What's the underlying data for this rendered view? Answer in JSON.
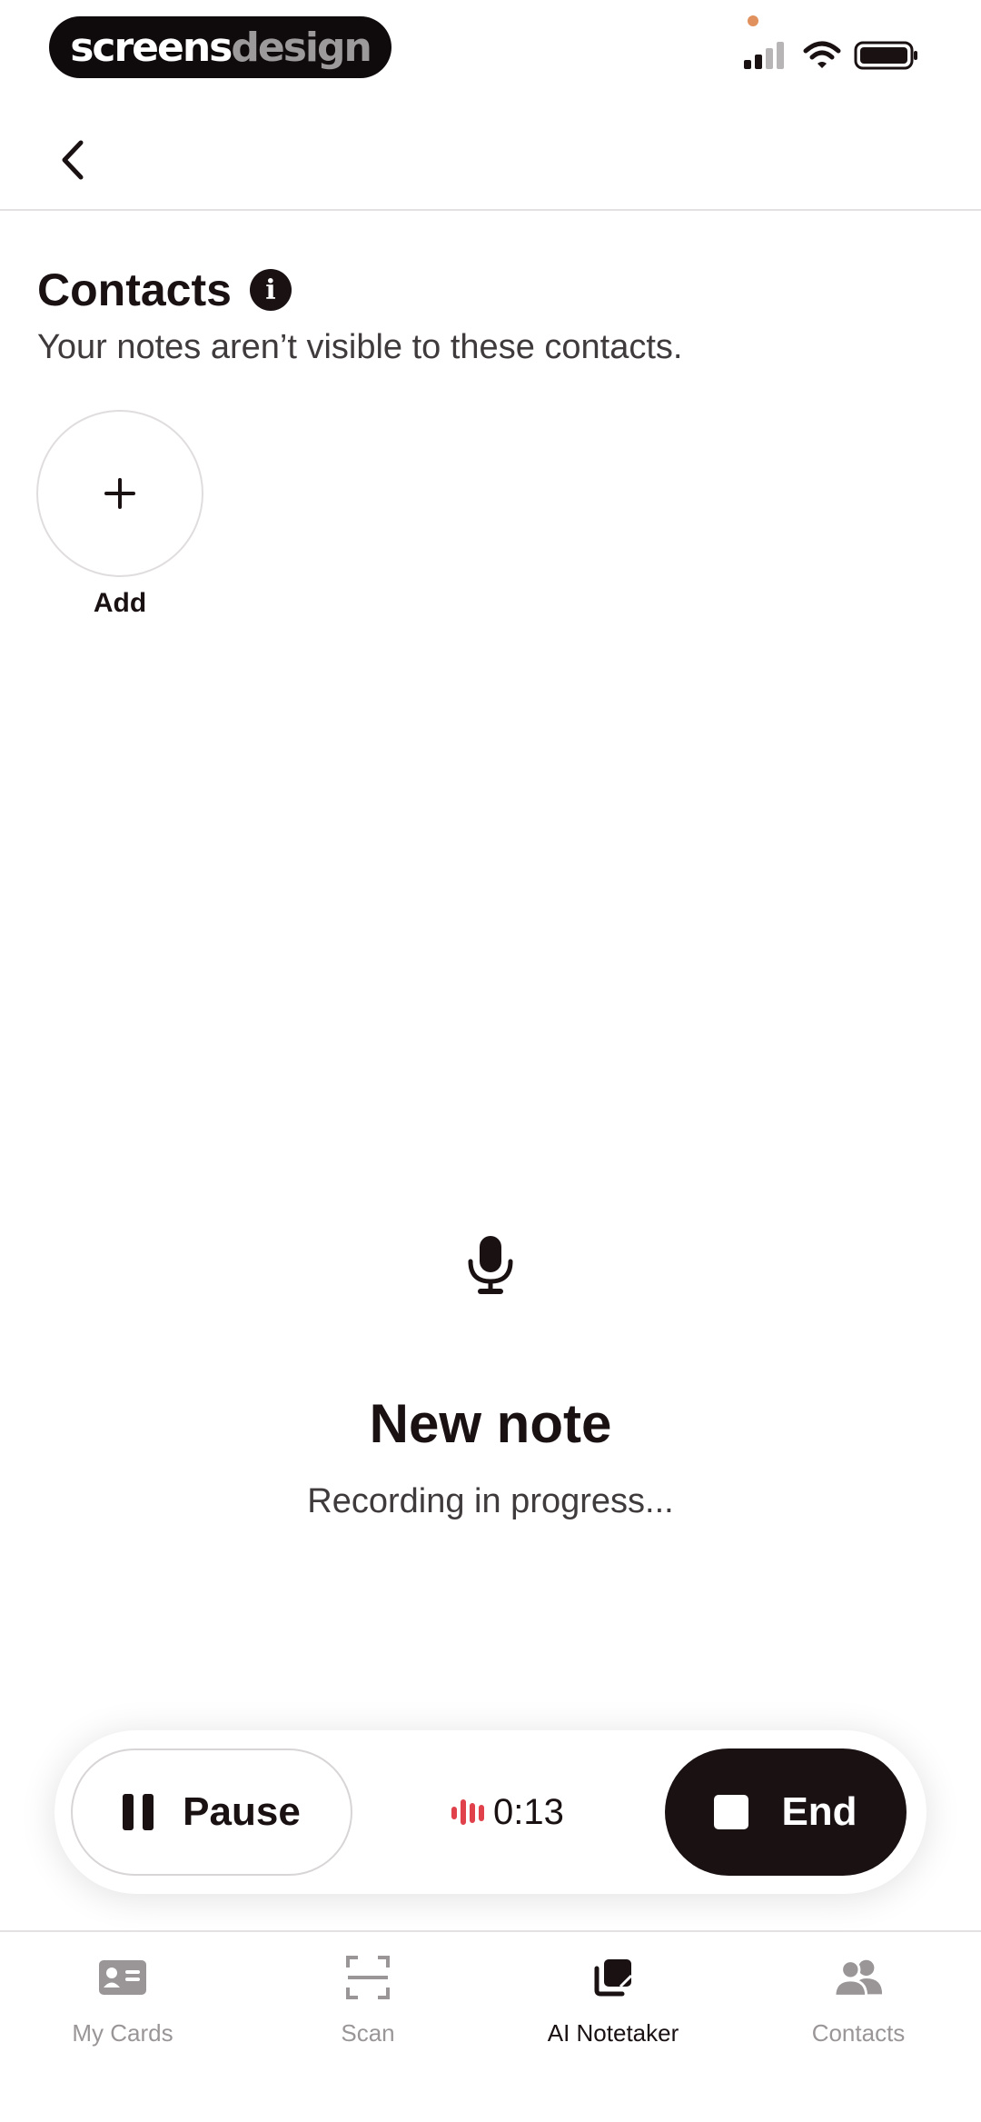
{
  "status_bar": {
    "brand_part1": "screens",
    "brand_part2": "design"
  },
  "contacts": {
    "title": "Contacts",
    "info_glyph": "i",
    "subtitle": "Your notes aren’t visible to these contacts.",
    "add_label": "Add"
  },
  "note": {
    "title": "New note",
    "status": "Recording in progress..."
  },
  "controls": {
    "pause_label": "Pause",
    "timer": "0:13",
    "end_label": "End"
  },
  "tabs": [
    {
      "label": "My Cards",
      "icon": "id-card-icon",
      "active": false
    },
    {
      "label": "Scan",
      "icon": "scan-icon",
      "active": false
    },
    {
      "label": "AI Notetaker",
      "icon": "notes-stack-icon",
      "active": true
    },
    {
      "label": "Contacts",
      "icon": "people-icon",
      "active": false
    }
  ],
  "colors": {
    "primary": "#1a1113",
    "inactive": "#9a9697",
    "recording": "#e0414b",
    "status_dot": "#e0915e"
  }
}
